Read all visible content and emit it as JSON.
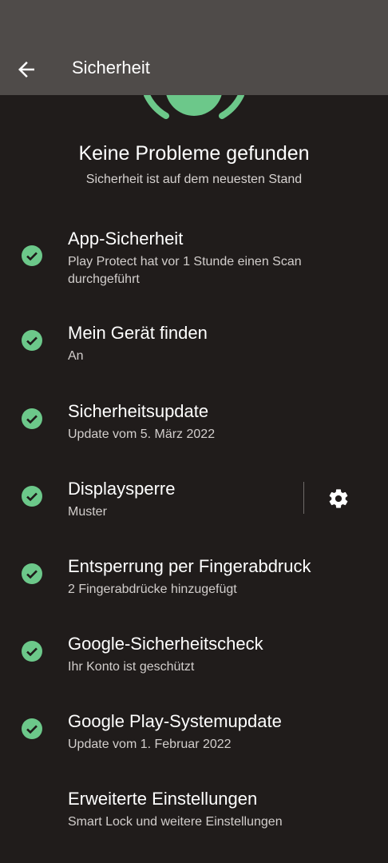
{
  "appbar": {
    "title": "Sicherheit"
  },
  "summary": {
    "title": "Keine Probleme gefunden",
    "subtitle": "Sicherheit ist auf dem neuesten Stand"
  },
  "items": [
    {
      "title": "App-Sicherheit",
      "subtitle": "Play Protect hat vor 1 Stunde einen Scan durchgeführt"
    },
    {
      "title": "Mein Gerät finden",
      "subtitle": "An"
    },
    {
      "title": "Sicherheitsupdate",
      "subtitle": "Update vom 5. März 2022"
    },
    {
      "title": "Displaysperre",
      "subtitle": "Muster"
    },
    {
      "title": "Entsperrung per Fingerabdruck",
      "subtitle": "2 Fingerabdrücke hinzugefügt"
    },
    {
      "title": "Google-Sicherheitscheck",
      "subtitle": "Ihr Konto ist geschützt"
    },
    {
      "title": "Google Play-Systemupdate",
      "subtitle": "Update vom 1. Februar 2022"
    },
    {
      "title": "Erweiterte Einstellungen",
      "subtitle": "Smart Lock und weitere Einstellungen"
    }
  ],
  "colors": {
    "accent_green": "#6cc88a",
    "appbar": "#4f4b49",
    "background": "#201c1b"
  },
  "icons": {
    "back": "arrow-left",
    "check": "check-circle",
    "settings": "gear"
  }
}
